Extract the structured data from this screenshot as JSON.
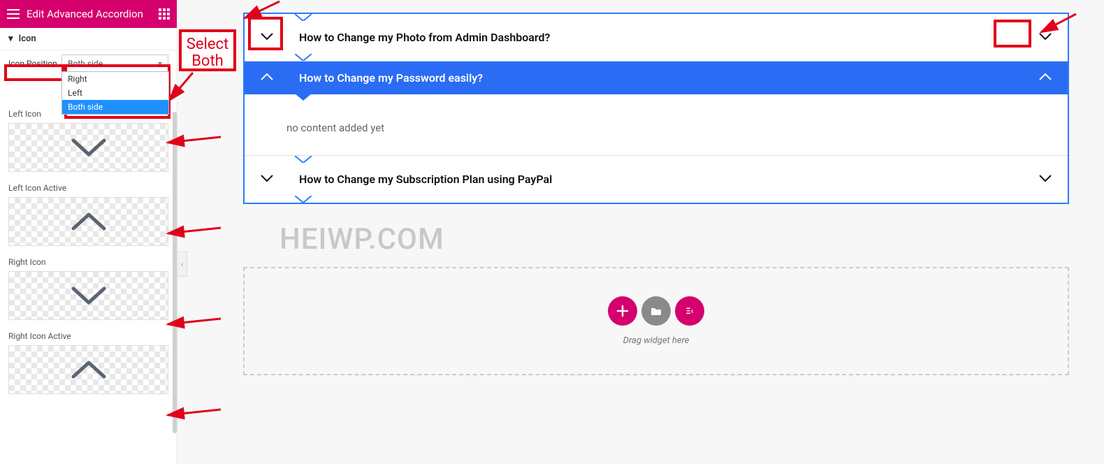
{
  "sidebar": {
    "header_title": "Edit Advanced Accordion",
    "section_icon": "Icon",
    "icon_position_label": "Icon Position",
    "icon_position_value": "Both side",
    "dropdown_options": [
      "Right",
      "Left",
      "Both side"
    ],
    "left_icon_label": "Left Icon",
    "left_icon_active_label": "Left Icon Active",
    "right_icon_label": "Right Icon",
    "right_icon_active_label": "Right Icon Active"
  },
  "annotation": {
    "select_both": "Select\nBoth"
  },
  "accordion": {
    "items": [
      {
        "title": "How to Change my Photo from Admin Dashboard?",
        "open": false
      },
      {
        "title": "How to Change my Password easily?",
        "open": true,
        "body": "no content added yet"
      },
      {
        "title": "How to Change my Subscription Plan using PayPal",
        "open": false
      }
    ]
  },
  "drop_area": {
    "label": "Drag widget here"
  },
  "watermark": "HEIWP.COM"
}
